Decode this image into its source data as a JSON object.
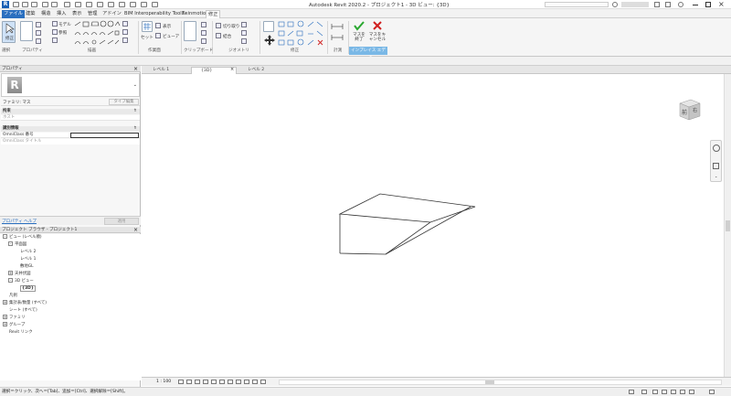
{
  "window": {
    "title": "Autodesk Revit 2020.2 - プロジェクト1 - 3D ビュー: {3D}"
  },
  "ribbon_tabs": [
    "ファイル",
    "建築",
    "構造",
    "挿入",
    "表示",
    "管理",
    "アドイン",
    "BIM Interoperability Tools",
    "Twinmotion",
    "修正"
  ],
  "ribbon": {
    "modify_label": "修正",
    "model_label": "モデル",
    "reference_label": "参照",
    "show_label": "表示",
    "viewer_label": "ビューア",
    "set_label": "セット",
    "cut_label": "切り取り",
    "join_label": "結合",
    "finish_mass_label": "マスを終了",
    "cancel_mass_label": "マスをキャンセル",
    "groups": [
      "選択",
      "プロパティ",
      "描画",
      "作業面",
      "クリップボード",
      "ジオメトリ",
      "修正",
      "計測",
      "インプレイス エディタ"
    ]
  },
  "properties": {
    "header": "プロパティ",
    "type_name": "ファミリ: マス",
    "edit_type": "タイプ編集",
    "section_constraints": "拘束",
    "constraint_item": "ホスト",
    "section_identity": "識別情報",
    "omniclass_number": "OmniClass 番号",
    "omniclass_title": "OmniClass タイトル",
    "help_link": "プロパティ ヘルプ",
    "apply_button": "適用"
  },
  "browser": {
    "header": "プロジェクト ブラウザ - プロジェクト1",
    "items": [
      {
        "label": "ビュー (レベル順)",
        "indent": 0,
        "toggle": "-"
      },
      {
        "label": "平面図",
        "indent": 1,
        "toggle": "-"
      },
      {
        "label": "レベル 2",
        "indent": 2,
        "toggle": ""
      },
      {
        "label": "レベル 1",
        "indent": 2,
        "toggle": ""
      },
      {
        "label": "敷地GL",
        "indent": 2,
        "toggle": ""
      },
      {
        "label": "天井伏図",
        "indent": 1,
        "toggle": "+"
      },
      {
        "label": "3D ビュー",
        "indent": 1,
        "toggle": "-"
      },
      {
        "label": "{3D}",
        "indent": 2,
        "toggle": "",
        "bold": true
      },
      {
        "label": "凡例",
        "indent": 0,
        "toggle": ""
      },
      {
        "label": "集計表/数量 (すべて)",
        "indent": 0,
        "toggle": "+"
      },
      {
        "label": "シート (すべて)",
        "indent": 0,
        "toggle": ""
      },
      {
        "label": "ファミリ",
        "indent": 0,
        "toggle": "+"
      },
      {
        "label": "グループ",
        "indent": 0,
        "toggle": "+"
      },
      {
        "label": "Revit リンク",
        "indent": 0,
        "toggle": ""
      }
    ]
  },
  "view_tabs": [
    {
      "label": "レベル 1",
      "active": false
    },
    {
      "label": "{3D}",
      "active": true
    },
    {
      "label": "レベル 2",
      "active": false
    }
  ],
  "viewcube": {
    "front": "前",
    "right": "右"
  },
  "view_controls": {
    "scale": "1 : 100"
  },
  "status": {
    "text": "選択＝クリック、次へ＝[Tab]、追加＝[Ctrl]、選択解除＝[Shift]。"
  },
  "colors": {
    "accent": "#2a6fbf",
    "context": "#7ab8e6"
  }
}
